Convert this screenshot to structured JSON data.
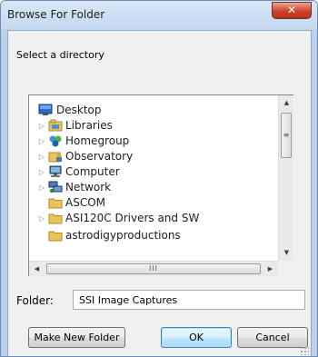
{
  "window": {
    "title": "Browse For Folder",
    "close_glyph": "✕"
  },
  "dialog": {
    "prompt": "Select a directory"
  },
  "tree": {
    "items": [
      {
        "label": "Desktop",
        "icon": "desktop-icon"
      },
      {
        "label": "Libraries",
        "icon": "libraries-icon",
        "expander": "▷"
      },
      {
        "label": "Homegroup",
        "icon": "homegroup-icon",
        "expander": "▷"
      },
      {
        "label": "Observatory",
        "icon": "user-folder-icon",
        "expander": "▷"
      },
      {
        "label": "Computer",
        "icon": "computer-icon",
        "expander": "▷"
      },
      {
        "label": "Network",
        "icon": "network-icon",
        "expander": "▷"
      },
      {
        "label": "ASCOM",
        "icon": "folder-icon"
      },
      {
        "label": "ASI120C Drivers and SW",
        "icon": "folder-icon",
        "expander": "▷"
      },
      {
        "label": "astrodigyproductions",
        "icon": "folder-icon"
      }
    ],
    "scroll": {
      "up": "▲",
      "down": "▼",
      "left": "◀",
      "right": "▶",
      "v_grip": "≡",
      "h_grip": "III"
    }
  },
  "folder": {
    "label": "Folder:",
    "value": "SSI Image Captures"
  },
  "buttons": {
    "make_new_folder": "Make New Folder",
    "ok": "OK",
    "cancel": "Cancel"
  },
  "colors": {
    "title_bar": "#c2d8ef",
    "close_button": "#c9452a",
    "dialog_background": "#f0f0f0",
    "folder_yellow": "#e8c45a"
  }
}
